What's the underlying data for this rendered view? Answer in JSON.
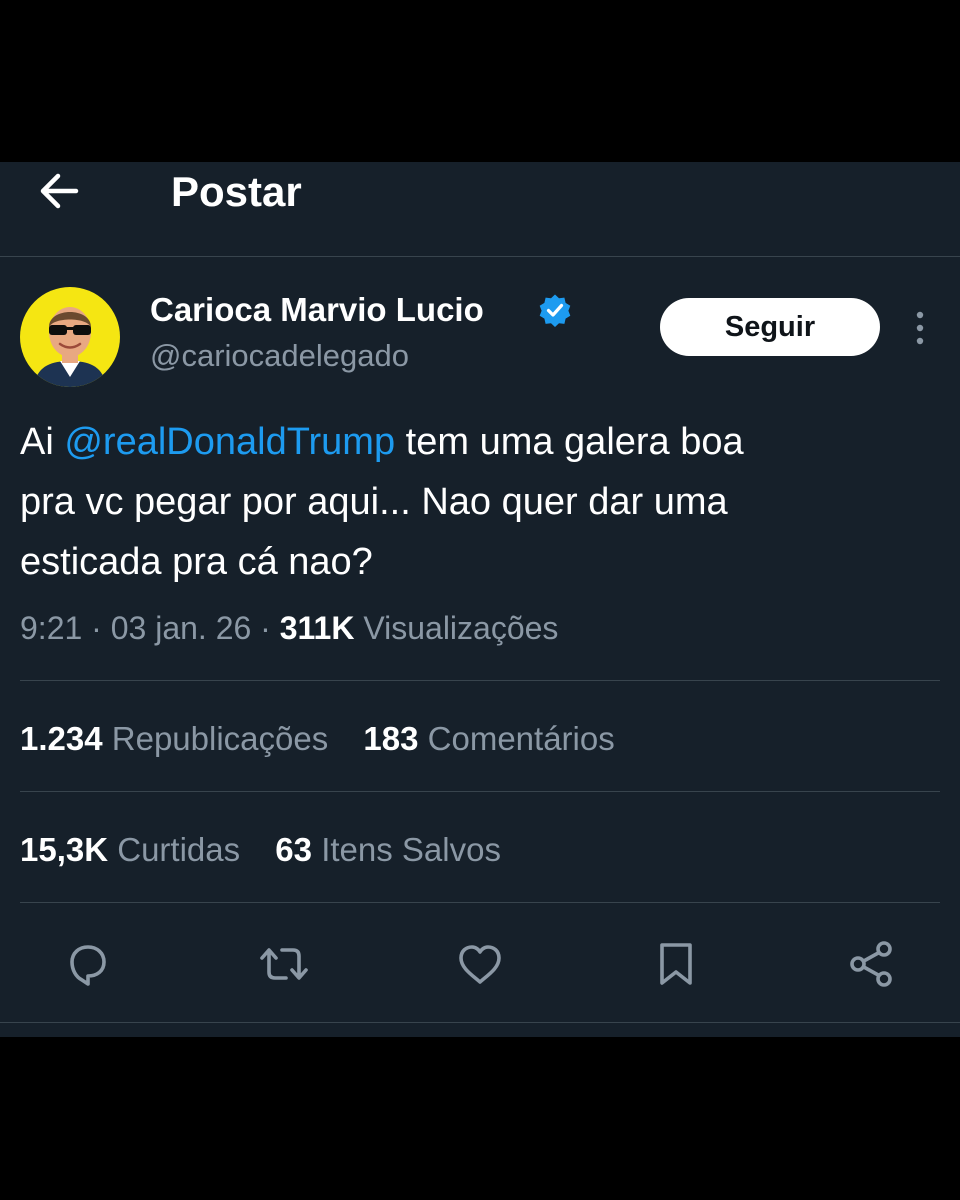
{
  "header": {
    "title": "Postar",
    "back_icon": "arrow-left-icon"
  },
  "author": {
    "name": "Carioca Marvio Lucio",
    "handle": "@cariocadelegado",
    "verified": true,
    "avatar_icon": "profile-photo-man-sunglasses",
    "follow_label": "Seguir"
  },
  "tweet": {
    "lines": [
      {
        "prefix": "Ai ",
        "mention": "@realDonaldTrump",
        "suffix": " tem uma galera boa"
      },
      {
        "text": "pra vc pegar por aqui... Nao quer dar uma"
      },
      {
        "text": "esticada pra cá nao?"
      }
    ]
  },
  "meta": {
    "time": "9:21",
    "separator": "·",
    "date": "03 jan. 26",
    "views": "311K",
    "views_label": "Visualizações"
  },
  "stats": {
    "reposts": {
      "value": "1.234",
      "label": "Republicações"
    },
    "comments": {
      "value": "183",
      "label": "Comentários"
    },
    "likes": {
      "value": "15,3K",
      "label": "Curtidas"
    },
    "saves": {
      "value": "63",
      "label": "Itens Salvos"
    }
  },
  "actions": [
    "reply-icon",
    "repost-icon",
    "like-icon",
    "bookmark-icon",
    "share-icon"
  ],
  "colors": {
    "background": "#16202a",
    "accent": "#1d9bf0",
    "muted": "#8b98a5",
    "border": "#38444d",
    "avatar_bg": "#f5e612"
  }
}
